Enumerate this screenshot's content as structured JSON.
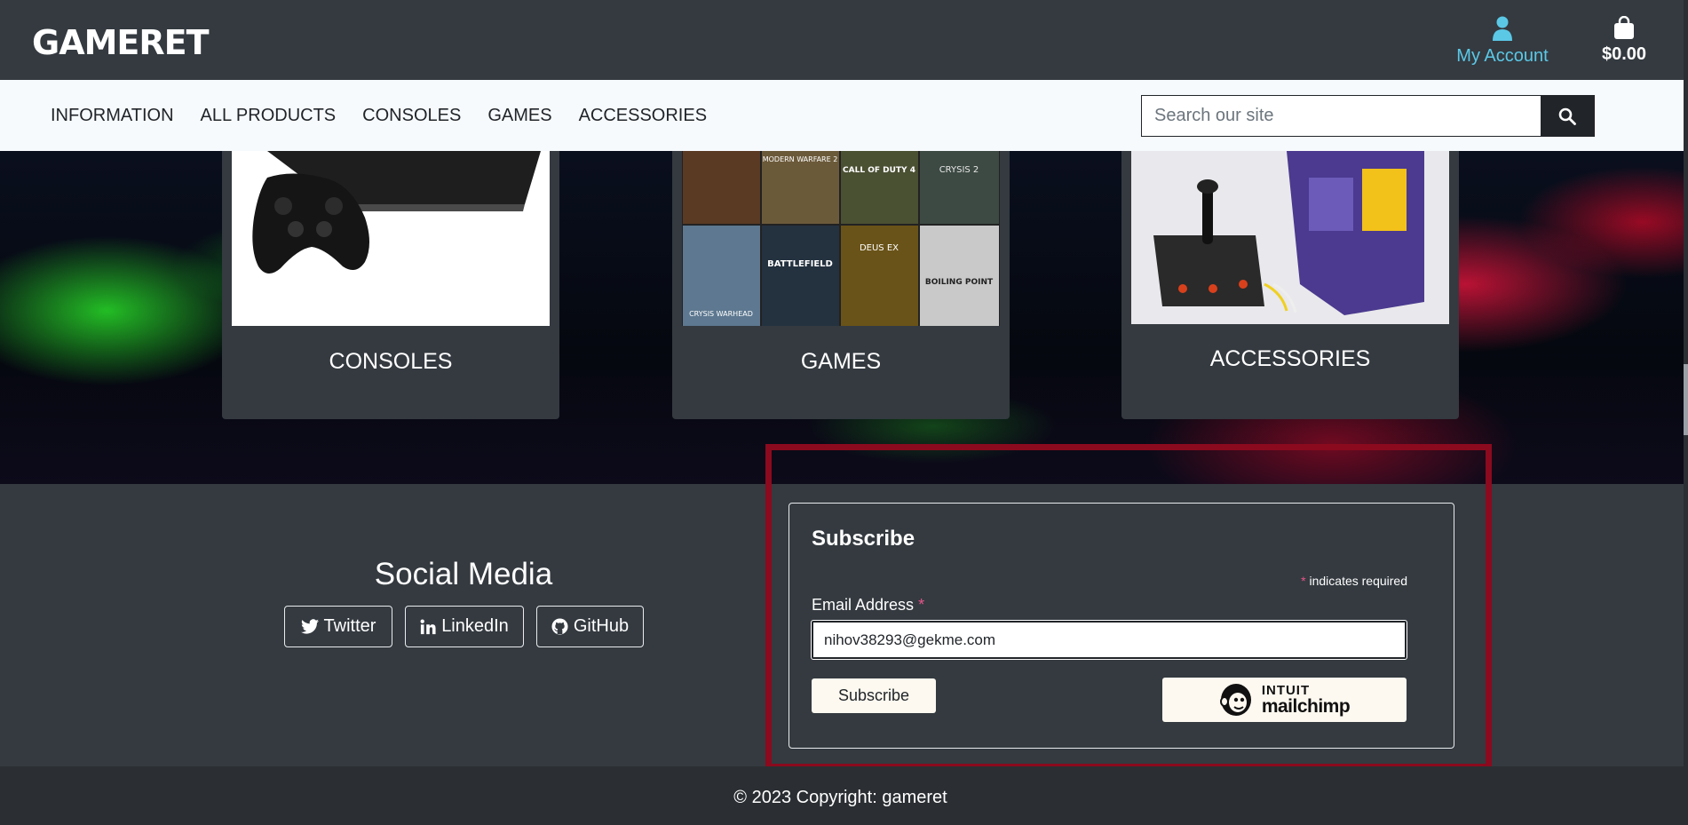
{
  "header": {
    "logo": "GAMERET",
    "account_label": "My Account",
    "cart_total": "$0.00"
  },
  "nav": {
    "items": [
      "INFORMATION",
      "ALL PRODUCTS",
      "CONSOLES",
      "GAMES",
      "ACCESSORIES"
    ],
    "search_placeholder": "Search our site"
  },
  "categories": [
    {
      "label": "CONSOLES",
      "image": "console-controller-image"
    },
    {
      "label": "GAMES",
      "image": "game-covers-collage-image"
    },
    {
      "label": "ACCESSORIES",
      "image": "joystick-accessory-image"
    }
  ],
  "game_covers": [
    "",
    "MODERN WARFARE 2",
    "CALL OF DUTY 4",
    "CRYSIS 2",
    "CRYSIS WARHEAD",
    "BATTLEFIELD",
    "DEUS EX",
    "BOILING POINT"
  ],
  "social": {
    "title": "Social Media",
    "links": [
      "Twitter",
      "LinkedIn",
      "GitHub"
    ]
  },
  "subscribe": {
    "title": "Subscribe",
    "required_note": "indicates required",
    "required_mark": "*",
    "email_label": "Email Address",
    "email_value": "nihov38293@gekme.com",
    "button_label": "Subscribe",
    "badge_intuit": "INTUIT",
    "badge_mailchimp": "mailchimp"
  },
  "footer": {
    "copyright": "© 2023 Copyright: gameret"
  },
  "colors": {
    "header_bg": "#343a40",
    "nav_bg": "#f7fafd",
    "accent": "#5bc8e6",
    "highlight": "#8b0a1e",
    "required": "#e7558a"
  }
}
